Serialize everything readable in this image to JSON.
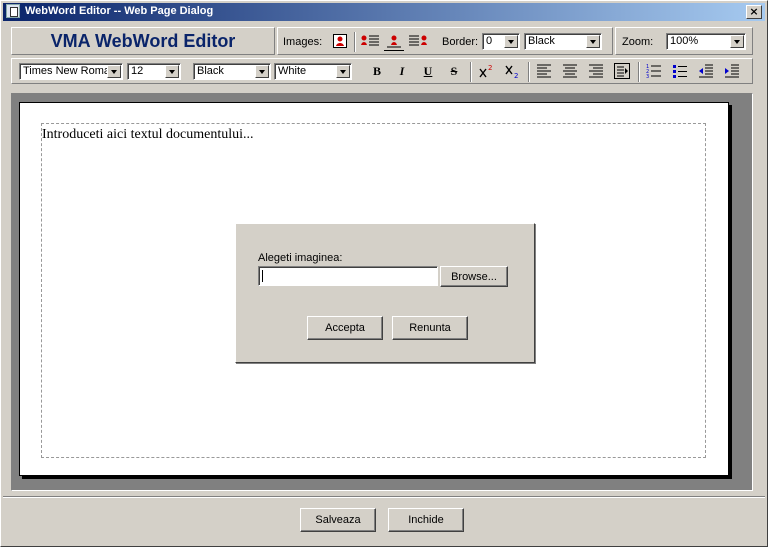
{
  "window": {
    "title": "WebWord Editor -- Web Page Dialog",
    "close_glyph": "×"
  },
  "toolbar": {
    "brand": "VMA WebWord Editor",
    "images_label": "Images:",
    "border_label": "Border:",
    "border_value": "0",
    "border_color": "Black",
    "zoom_label": "Zoom:",
    "zoom_value": "100%",
    "font_family": "Times New Roman",
    "font_size": "12",
    "font_color": "Black",
    "bg_color": "White",
    "bold": "B",
    "italic": "I",
    "underline": "U",
    "strike": "S"
  },
  "editor": {
    "placeholder_text": "Introduceti aici textul documentului..."
  },
  "image_dialog": {
    "label": "Alegeti imaginea:",
    "file_value": "",
    "browse_label": "Browse...",
    "accept_label": "Accepta",
    "cancel_label": "Renunta"
  },
  "footer": {
    "save_label": "Salveaza",
    "close_label": "Inchide"
  }
}
